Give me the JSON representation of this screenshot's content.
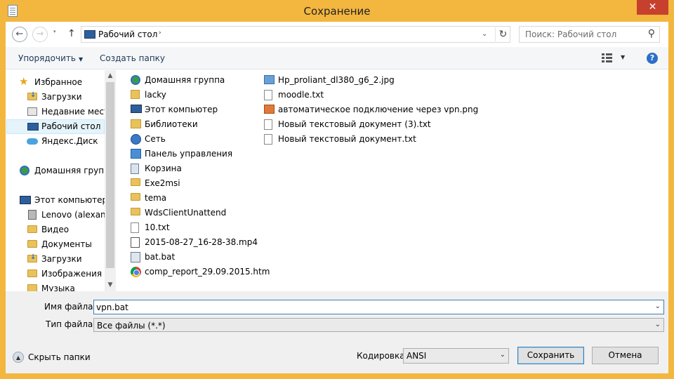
{
  "window": {
    "title": "Сохранение",
    "close_glyph": "✕",
    "app_icon": "notepad-document-icon"
  },
  "address_bar": {
    "back_icon": "back-arrow-icon",
    "back_glyph": "←",
    "forward_icon": "forward-arrow-icon",
    "forward_glyph": "→",
    "history_glyph": "▾",
    "up_glyph": "↑",
    "location_icon": "desktop-icon",
    "breadcrumb": "Рабочий стол",
    "breadcrumb_separator": "›",
    "dropdown_glyph": "⌄",
    "refresh_glyph": "↻"
  },
  "search": {
    "placeholder": "Поиск: Рабочий стол",
    "icon_glyph": "⚲"
  },
  "toolbar": {
    "organize_label": "Упорядочить",
    "organize_caret": "▼",
    "new_folder_label": "Создать папку",
    "view_dropdown": "▼",
    "help_glyph": "?"
  },
  "nav_pane": {
    "items": [
      {
        "label": "Избранное",
        "icon": "star-icon",
        "glyph": "★",
        "level": 0
      },
      {
        "label": "Загрузки",
        "icon": "downloads-folder-icon",
        "level": 1
      },
      {
        "label": "Недавние места",
        "icon": "recent-places-icon",
        "level": 1
      },
      {
        "label": "Рабочий стол",
        "icon": "desktop-icon",
        "level": 1,
        "selected": true
      },
      {
        "label": "Яндекс.Диск",
        "icon": "yandex-disk-icon",
        "level": 1
      },
      {
        "label": "Домашняя группа",
        "icon": "homegroup-icon",
        "level": 0
      },
      {
        "label": "Этот компьютер",
        "icon": "computer-icon",
        "level": 0
      },
      {
        "label": "Lenovo (alexander",
        "icon": "drive-icon",
        "level": 1
      },
      {
        "label": "Видео",
        "icon": "videos-folder-icon",
        "level": 1
      },
      {
        "label": "Документы",
        "icon": "documents-folder-icon",
        "level": 1
      },
      {
        "label": "Загрузки",
        "icon": "downloads-folder-icon",
        "level": 1
      },
      {
        "label": "Изображения",
        "icon": "pictures-folder-icon",
        "level": 1
      },
      {
        "label": "Музыка",
        "icon": "music-folder-icon",
        "level": 1
      }
    ],
    "scroll_up": "▲",
    "scroll_down": "▼"
  },
  "files": {
    "column1": [
      {
        "name": "Домашняя группа",
        "icon": "homegroup-icon"
      },
      {
        "name": "lacky",
        "icon": "user-folder-icon"
      },
      {
        "name": "Этот компьютер",
        "icon": "computer-icon"
      },
      {
        "name": "Библиотеки",
        "icon": "libraries-icon"
      },
      {
        "name": "Сеть",
        "icon": "network-icon"
      },
      {
        "name": "Панель управления",
        "icon": "control-panel-icon"
      },
      {
        "name": "Корзина",
        "icon": "recycle-bin-icon"
      },
      {
        "name": "Exe2msi",
        "icon": "folder-icon"
      },
      {
        "name": "tema",
        "icon": "folder-icon"
      },
      {
        "name": "WdsClientUnattend",
        "icon": "folder-icon"
      },
      {
        "name": "10.txt",
        "icon": "text-file-icon"
      },
      {
        "name": "2015-08-27_16-28-38.mp4",
        "icon": "video-file-icon"
      },
      {
        "name": "bat.bat",
        "icon": "batch-file-icon"
      },
      {
        "name": "comp_report_29.09.2015.htm",
        "icon": "chrome-html-icon"
      }
    ],
    "column2": [
      {
        "name": "Hp_proliant_dl380_g6_2.jpg",
        "icon": "image-file-icon"
      },
      {
        "name": "moodle.txt",
        "icon": "text-file-icon"
      },
      {
        "name": "автоматическое подключение через vpn.png",
        "icon": "png-file-icon"
      },
      {
        "name": "Новый текстовый документ (3).txt",
        "icon": "text-file-icon"
      },
      {
        "name": "Новый текстовый документ.txt",
        "icon": "text-file-icon"
      }
    ]
  },
  "form": {
    "filename_label": "Имя файла:",
    "filename_value": "vpn.bat",
    "filetype_label": "Тип файла:",
    "filetype_value": "Все файлы  (*.*)",
    "dropdown_glyph": "⌄",
    "hide_folders_label": "Скрыть папки",
    "hide_folders_glyph": "▲",
    "encoding_label": "Кодировка:",
    "encoding_value": "ANSI",
    "save_label": "Сохранить",
    "cancel_label": "Отмена"
  }
}
